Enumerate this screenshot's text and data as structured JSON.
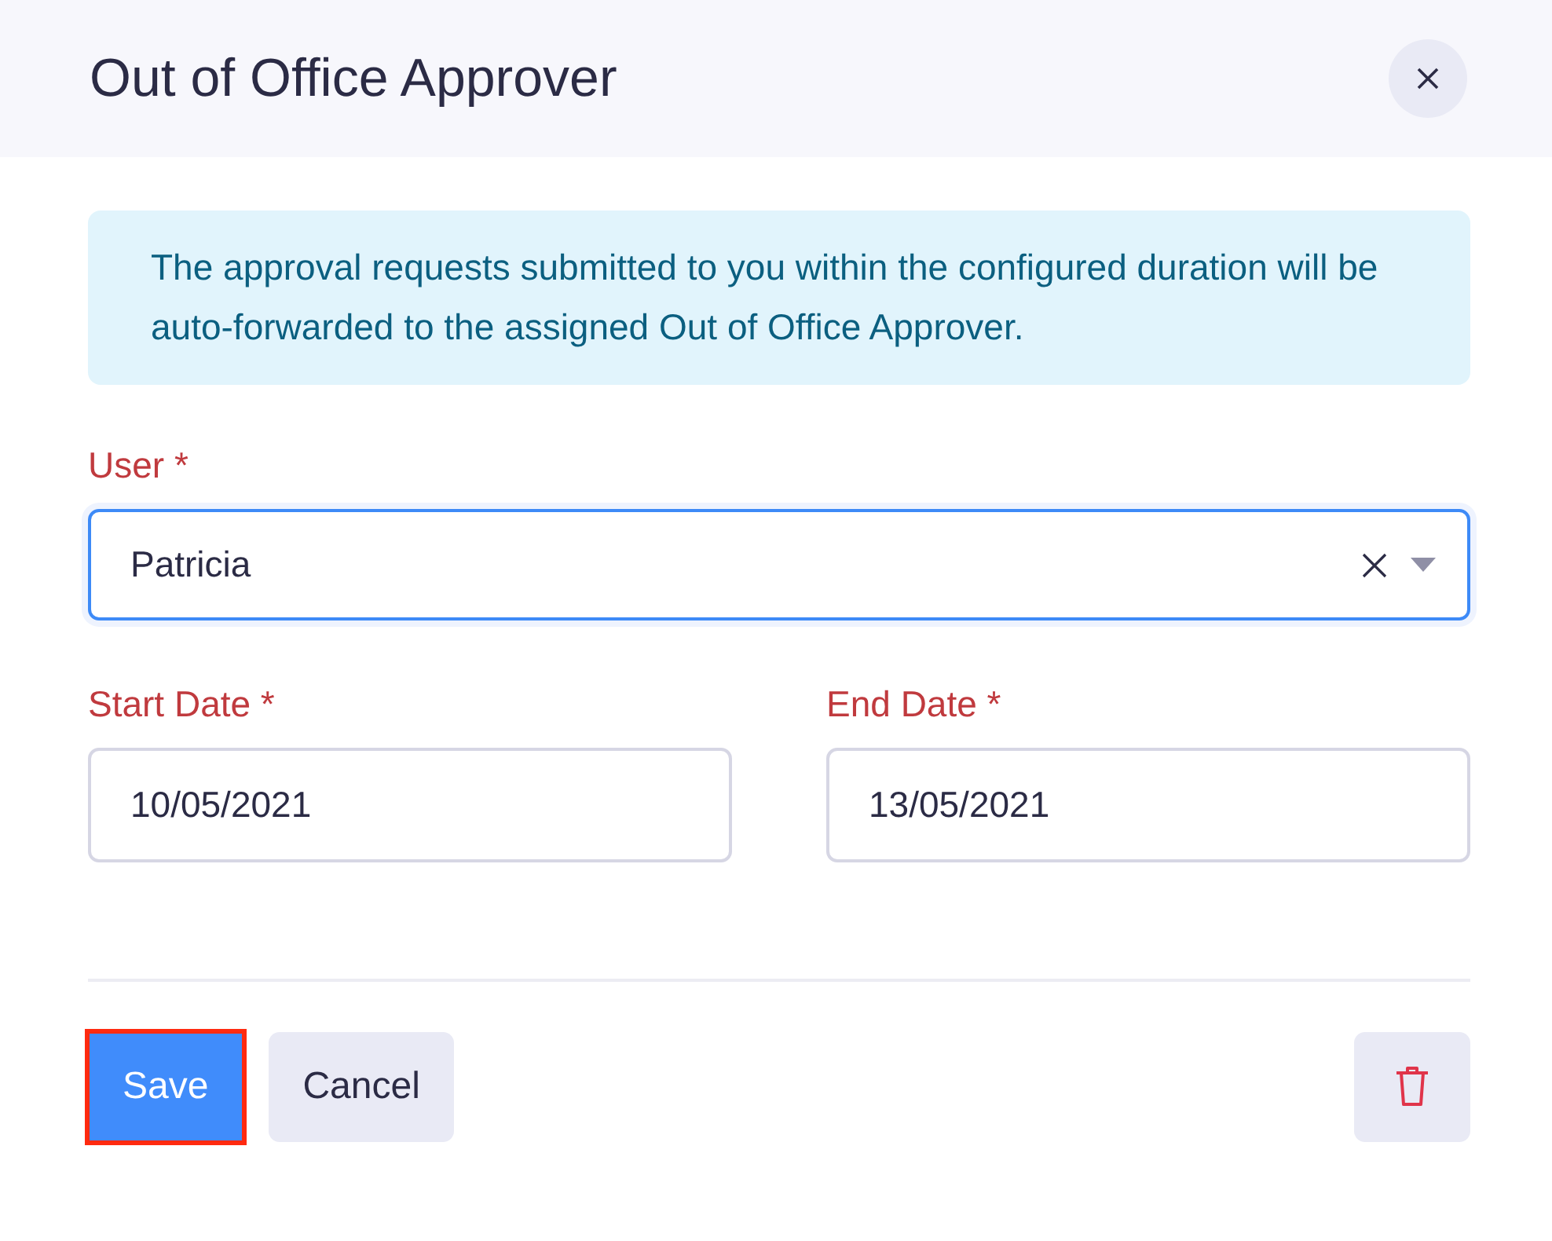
{
  "dialog": {
    "title": "Out of Office Approver"
  },
  "info": "The approval requests submitted to you within the configured duration will be auto-forwarded to the assigned Out of Office Approver.",
  "user_field": {
    "label": "User *",
    "value": "Patricia",
    "focused": true
  },
  "date_fields": [
    {
      "label": "Start Date *",
      "value": "10/05/2021"
    },
    {
      "label": "End Date *",
      "value": "13/05/2021"
    }
  ],
  "buttons": [
    {
      "label": "Save",
      "kind": "primary",
      "highlighted": true
    },
    {
      "label": "Cancel",
      "kind": "secondary",
      "highlighted": false
    }
  ]
}
